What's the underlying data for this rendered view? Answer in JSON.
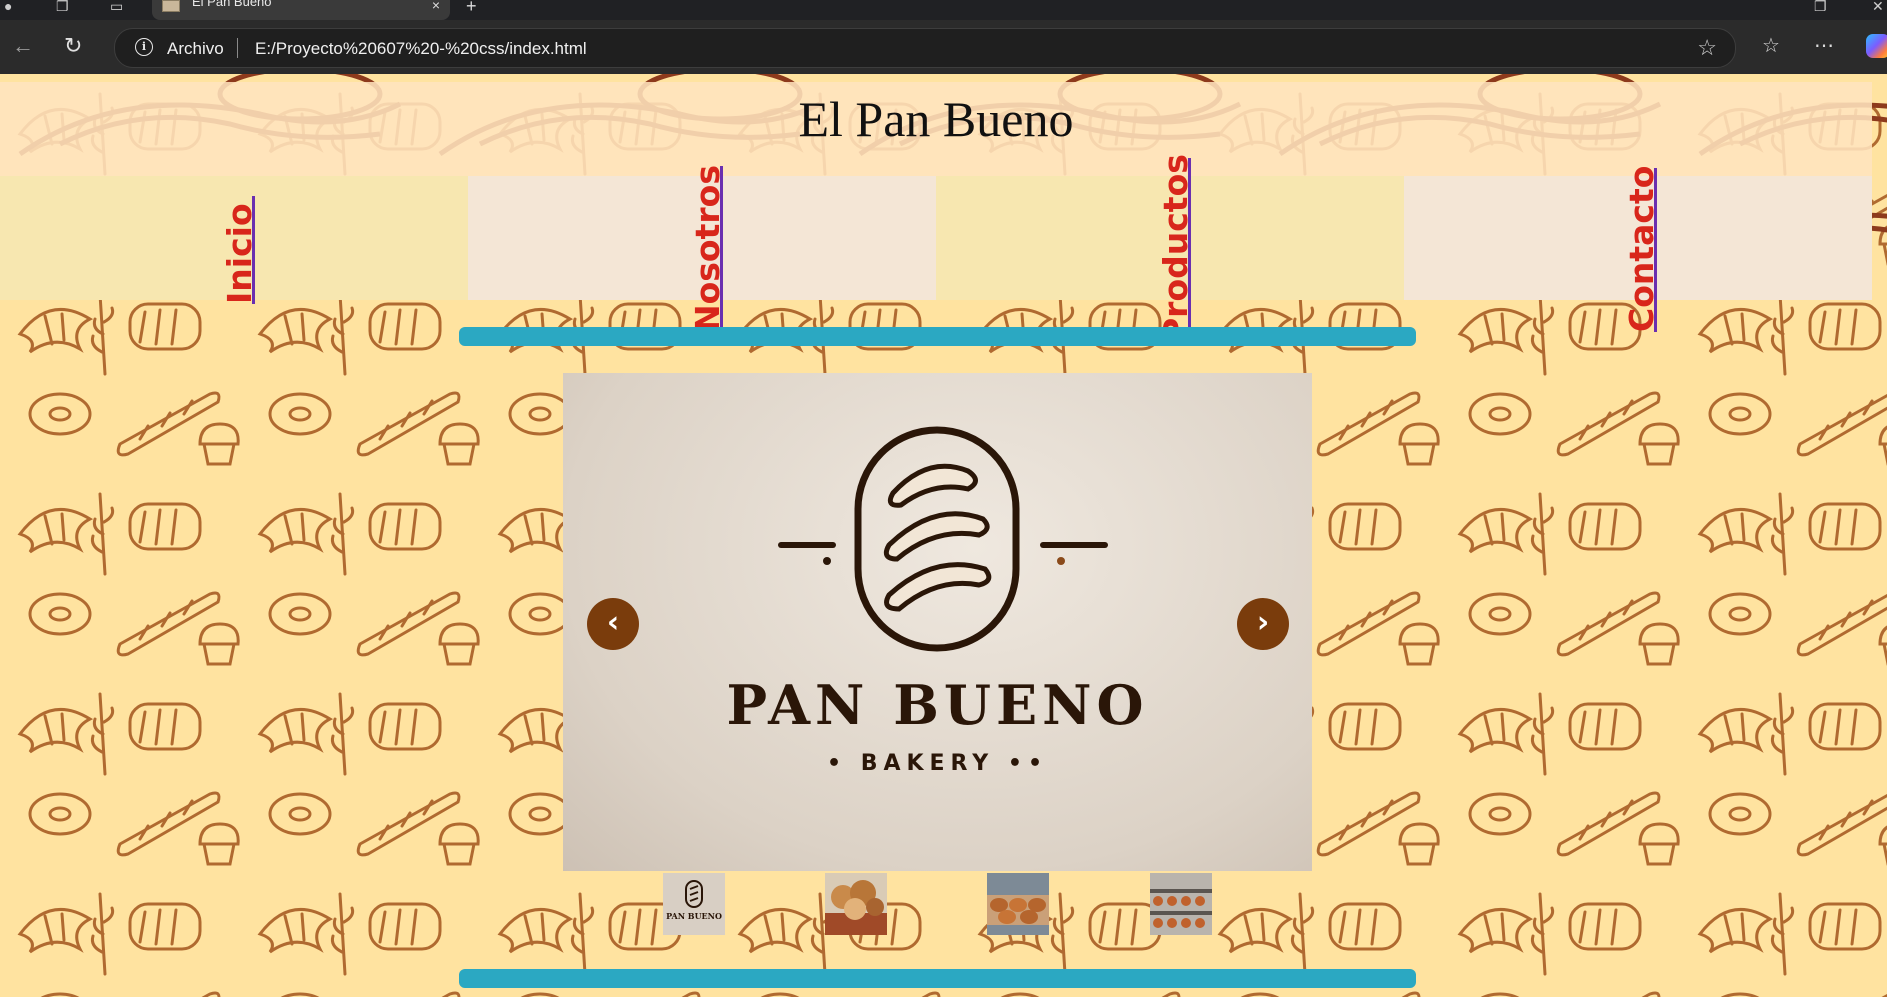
{
  "browser": {
    "tab_title": "El Pan Bueno",
    "close_glyph": "×",
    "newtab_glyph": "+",
    "address_scheme_label": "Archivo",
    "url": "E:/Proyecto%20607%20-%20css/index.html"
  },
  "page": {
    "title": "El Pan Bueno",
    "nav": [
      {
        "label": "Inicio"
      },
      {
        "label": "Nosotros"
      },
      {
        "label": "Productos"
      },
      {
        "label": "Contacto"
      }
    ],
    "slider": {
      "logo_title": "PAN BUENO",
      "logo_subtitle": "• BAKERY ••",
      "prev_glyph": "‹",
      "next_glyph": "›",
      "thumbnail_count": 4,
      "thumb_logo_text": "PAN BUENO"
    },
    "colors": {
      "nav_text": "#d8261b",
      "accent_bar": "#2ba8c2",
      "arrow_bg": "#7a3c0c",
      "page_bg": "#ffe3a0"
    }
  }
}
